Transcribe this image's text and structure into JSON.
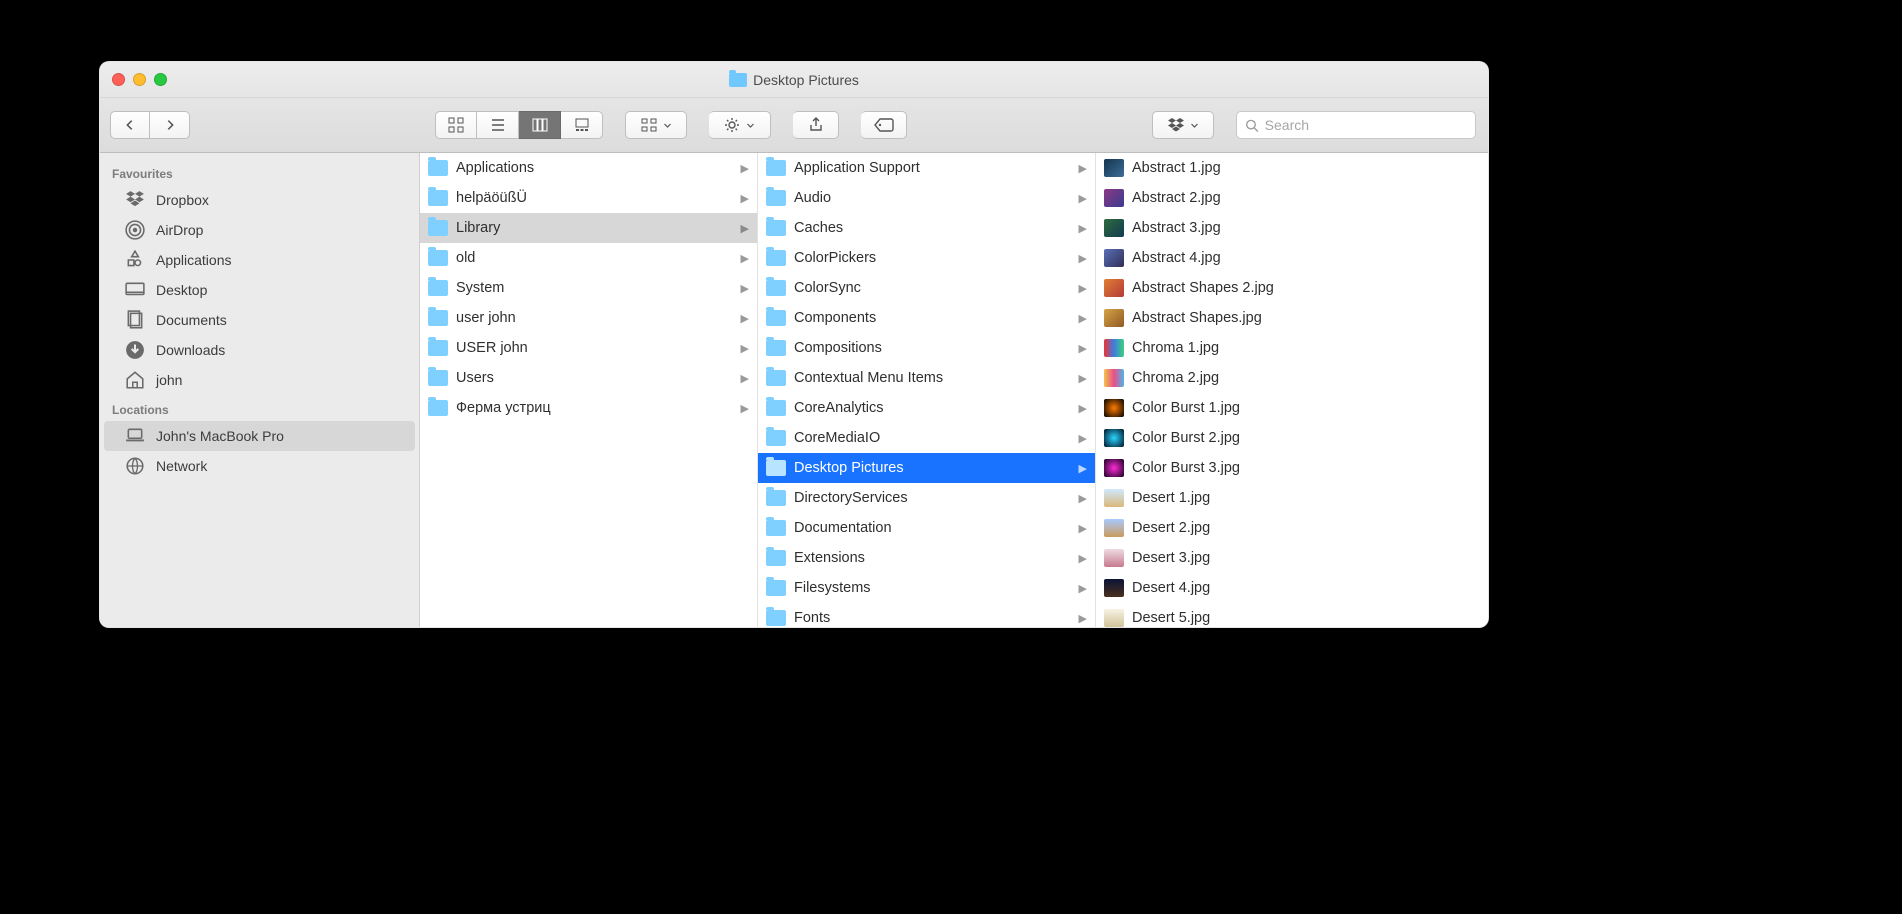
{
  "window": {
    "title": "Desktop Pictures"
  },
  "search": {
    "placeholder": "Search"
  },
  "sidebar": {
    "sections": [
      {
        "heading": "Favourites",
        "items": [
          {
            "label": "Dropbox",
            "icon": "dropbox"
          },
          {
            "label": "AirDrop",
            "icon": "airdrop"
          },
          {
            "label": "Applications",
            "icon": "apps"
          },
          {
            "label": "Desktop",
            "icon": "desktop"
          },
          {
            "label": "Documents",
            "icon": "docs"
          },
          {
            "label": "Downloads",
            "icon": "downloads"
          },
          {
            "label": "john",
            "icon": "home"
          }
        ]
      },
      {
        "heading": "Locations",
        "items": [
          {
            "label": "John's MacBook Pro",
            "icon": "laptop",
            "selected": true
          },
          {
            "label": "Network",
            "icon": "network"
          }
        ]
      }
    ]
  },
  "columns": [
    {
      "items": [
        {
          "label": "Applications",
          "type": "folder",
          "hasChildren": true
        },
        {
          "label": "helpäöüßÜ",
          "type": "folder",
          "hasChildren": true
        },
        {
          "label": "Library",
          "type": "folder",
          "hasChildren": true,
          "state": "selected"
        },
        {
          "label": "old",
          "type": "folder",
          "hasChildren": true
        },
        {
          "label": "System",
          "type": "folder",
          "hasChildren": true
        },
        {
          "label": "user john",
          "type": "folder",
          "hasChildren": true
        },
        {
          "label": "USER john",
          "type": "folder",
          "hasChildren": true
        },
        {
          "label": "Users",
          "type": "folder",
          "hasChildren": true
        },
        {
          "label": "Ферма устриц",
          "type": "folder",
          "hasChildren": true
        }
      ]
    },
    {
      "items": [
        {
          "label": "Application Support",
          "type": "folder",
          "hasChildren": true
        },
        {
          "label": "Audio",
          "type": "folder",
          "hasChildren": true
        },
        {
          "label": "Caches",
          "type": "folder",
          "hasChildren": true
        },
        {
          "label": "ColorPickers",
          "type": "folder",
          "hasChildren": true
        },
        {
          "label": "ColorSync",
          "type": "folder",
          "hasChildren": true
        },
        {
          "label": "Components",
          "type": "folder",
          "hasChildren": true
        },
        {
          "label": "Compositions",
          "type": "folder",
          "hasChildren": true
        },
        {
          "label": "Contextual Menu Items",
          "type": "folder",
          "hasChildren": true
        },
        {
          "label": "CoreAnalytics",
          "type": "folder",
          "hasChildren": true
        },
        {
          "label": "CoreMediaIO",
          "type": "folder",
          "hasChildren": true
        },
        {
          "label": "Desktop Pictures",
          "type": "folder",
          "hasChildren": true,
          "state": "active"
        },
        {
          "label": "DirectoryServices",
          "type": "folder",
          "hasChildren": true
        },
        {
          "label": "Documentation",
          "type": "folder",
          "hasChildren": true
        },
        {
          "label": "Extensions",
          "type": "folder",
          "hasChildren": true
        },
        {
          "label": "Filesystems",
          "type": "folder",
          "hasChildren": true
        },
        {
          "label": "Fonts",
          "type": "folder",
          "hasChildren": true
        }
      ]
    },
    {
      "items": [
        {
          "label": "Abstract 1.jpg",
          "type": "image",
          "swatch": "linear-gradient(135deg,#14344e,#3c6e97)"
        },
        {
          "label": "Abstract 2.jpg",
          "type": "image",
          "swatch": "linear-gradient(135deg,#8b3a84,#3a3a8f)"
        },
        {
          "label": "Abstract 3.jpg",
          "type": "image",
          "swatch": "linear-gradient(135deg,#2e6b3d,#123a52)"
        },
        {
          "label": "Abstract 4.jpg",
          "type": "image",
          "swatch": "linear-gradient(135deg,#5b6fb8,#2f2f55)"
        },
        {
          "label": "Abstract Shapes 2.jpg",
          "type": "image",
          "swatch": "linear-gradient(135deg,#e07f33,#b23a3a)"
        },
        {
          "label": "Abstract Shapes.jpg",
          "type": "image",
          "swatch": "linear-gradient(135deg,#d6a346,#8f5a24)"
        },
        {
          "label": "Chroma 1.jpg",
          "type": "image",
          "swatch": "linear-gradient(90deg,#e33,#3c7de3,#3fd17a)"
        },
        {
          "label": "Chroma 2.jpg",
          "type": "image",
          "swatch": "linear-gradient(90deg,#f4c04a,#e84f8a,#4fb4e8)"
        },
        {
          "label": "Color Burst 1.jpg",
          "type": "image",
          "swatch": "radial-gradient(circle,#ff7a00,#000)"
        },
        {
          "label": "Color Burst 2.jpg",
          "type": "image",
          "swatch": "radial-gradient(circle,#2bd6ff,#001126)"
        },
        {
          "label": "Color Burst 3.jpg",
          "type": "image",
          "swatch": "radial-gradient(circle,#ff2bd6,#12001f)"
        },
        {
          "label": "Desert 1.jpg",
          "type": "image",
          "swatch": "linear-gradient(#cfe8ff,#d9b879)"
        },
        {
          "label": "Desert 2.jpg",
          "type": "image",
          "swatch": "linear-gradient(#a8caff,#c99a5c)"
        },
        {
          "label": "Desert 3.jpg",
          "type": "image",
          "swatch": "linear-gradient(#eedbe4,#c77b8e)"
        },
        {
          "label": "Desert 4.jpg",
          "type": "image",
          "swatch": "linear-gradient(#0b1435,#4a2f1f)"
        },
        {
          "label": "Desert 5.jpg",
          "type": "image",
          "swatch": "linear-gradient(#f7f2e4,#d1c49a)"
        }
      ]
    }
  ]
}
